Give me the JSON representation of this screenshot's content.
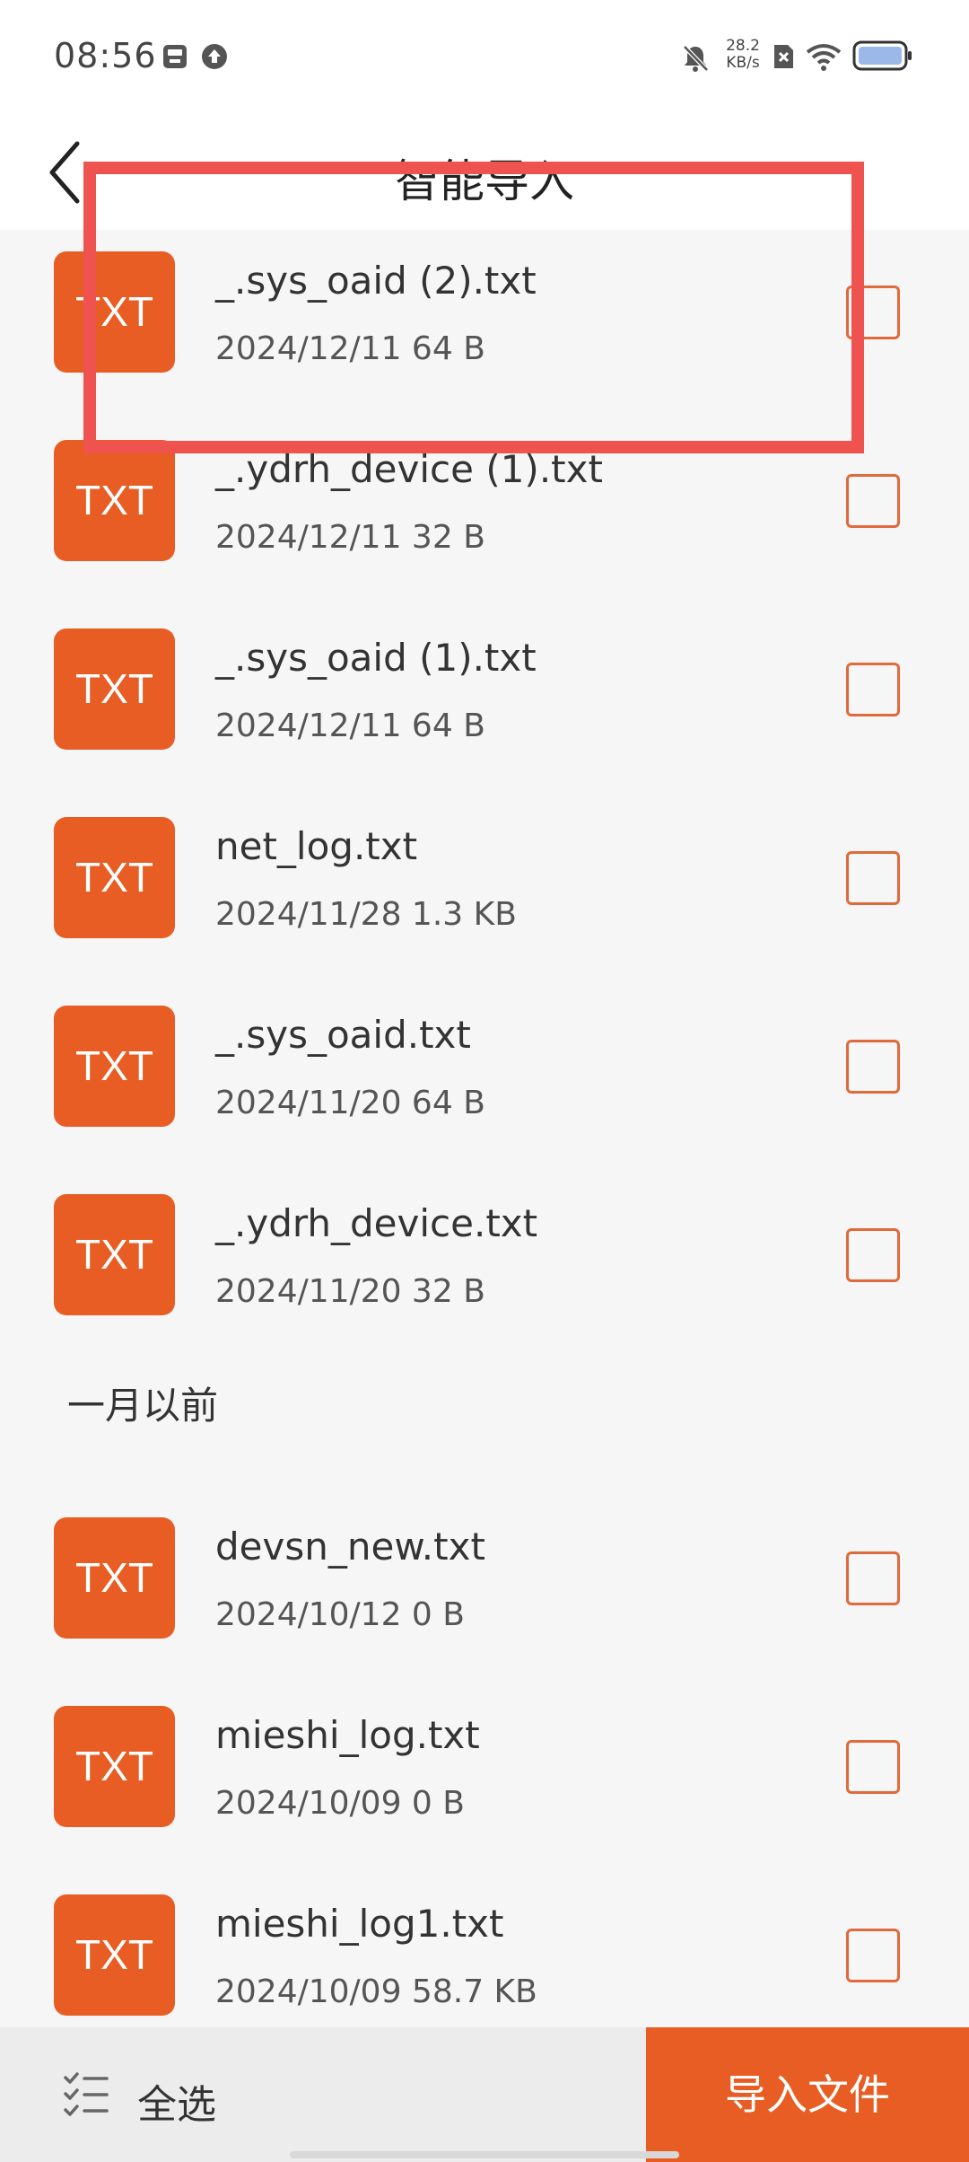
{
  "status_bar": {
    "time": "08:56",
    "net_speed_value": "28.2",
    "net_speed_unit": "KB/s",
    "icons": [
      "storage-icon",
      "upload-icon",
      "mute-bell-icon",
      "sim-x-icon",
      "wifi-icon",
      "battery-icon"
    ]
  },
  "header": {
    "title": "智能导入",
    "back_icon": "chevron-left-icon"
  },
  "files": [
    {
      "icon_label": "TXT",
      "name": "_.sys_oaid (2).txt",
      "meta": "2024/12/11 64 B"
    },
    {
      "icon_label": "TXT",
      "name": "_.ydrh_device (1).txt",
      "meta": "2024/12/11 32 B"
    },
    {
      "icon_label": "TXT",
      "name": "_.sys_oaid (1).txt",
      "meta": "2024/12/11 64 B"
    },
    {
      "icon_label": "TXT",
      "name": "net_log.txt",
      "meta": "2024/11/28 1.3 KB"
    },
    {
      "icon_label": "TXT",
      "name": "_.sys_oaid.txt",
      "meta": "2024/11/20 64 B"
    },
    {
      "icon_label": "TXT",
      "name": "_.ydrh_device.txt",
      "meta": "2024/11/20 32 B"
    },
    {
      "icon_label": "TXT",
      "name": "devsn_new.txt",
      "meta": "2024/10/12 0 B"
    },
    {
      "icon_label": "TXT",
      "name": "mieshi_log.txt",
      "meta": "2024/10/09 0 B"
    },
    {
      "icon_label": "TXT",
      "name": "mieshi_log1.txt",
      "meta": "2024/10/09 58.7 KB"
    }
  ],
  "section_header": "一月以前",
  "bottom_bar": {
    "select_all_label": "全选",
    "select_all_icon": "checklist-icon",
    "import_label": "导入文件"
  },
  "colors": {
    "accent": "#e85d24",
    "checkbox_border": "#e06a3c",
    "highlight": "#ef5350",
    "background": "#f6f6f6"
  }
}
